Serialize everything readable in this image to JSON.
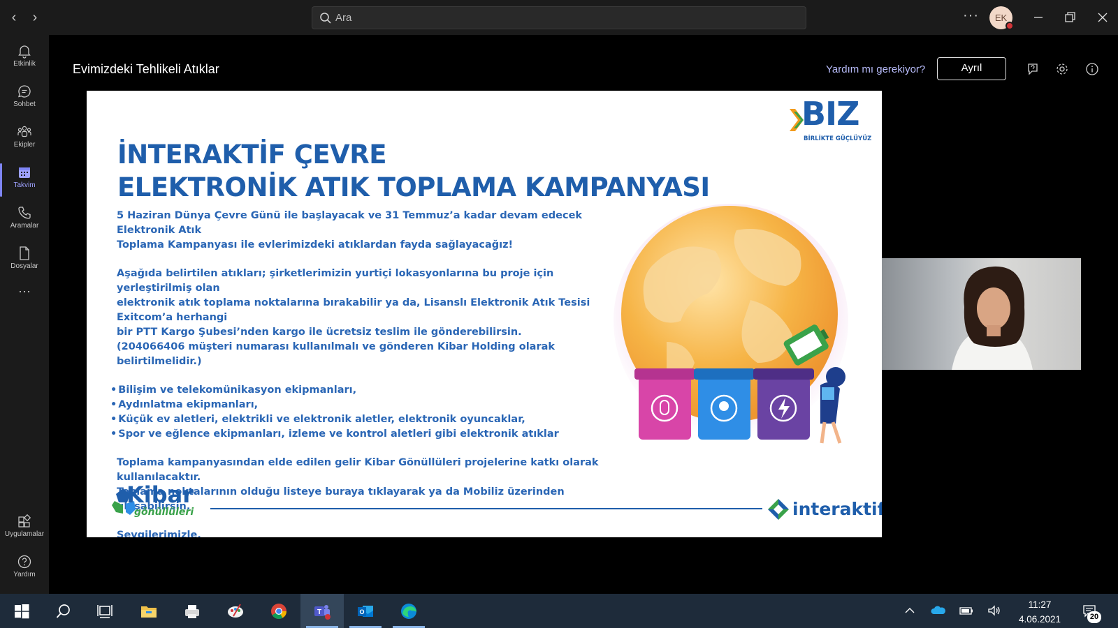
{
  "titlebar": {
    "search_placeholder": "Ara",
    "more_label": "···",
    "avatar_initials": "EK"
  },
  "rail": {
    "items": [
      {
        "label": "Etkinlik",
        "icon": "bell-icon"
      },
      {
        "label": "Sohbet",
        "icon": "chat-icon"
      },
      {
        "label": "Ekipler",
        "icon": "teams-icon"
      },
      {
        "label": "Takvim",
        "icon": "calendar-icon"
      },
      {
        "label": "Aramalar",
        "icon": "phone-icon"
      },
      {
        "label": "Dosyalar",
        "icon": "file-icon"
      }
    ],
    "more_label": "···",
    "bottom": [
      {
        "label": "Uygulamalar",
        "icon": "apps-icon"
      },
      {
        "label": "Yardım",
        "icon": "help-icon"
      }
    ],
    "active_index": 3
  },
  "meeting": {
    "title": "Evimizdeki Tehlikeli Atıklar",
    "help_link": "Yardım mı gerekiyor?",
    "leave_label": "Ayrıl"
  },
  "slide": {
    "heading_line1": "İNTERAKTİF ÇEVRE",
    "heading_line2": "ELEKTRONİK ATIK TOPLAMA KAMPANYASI",
    "para1_line1": "5 Haziran Dünya Çevre Günü ile başlayacak ve  31 Temmuz’a kadar devam edecek Elektronik Atık",
    "para1_line2": "Toplama Kampanyası ile evlerimizdeki atıklardan fayda sağlayacağız!",
    "para2_line1": "Aşağıda belirtilen atıkları; şirketlerimizin yurtiçi lokasyonlarına bu proje için yerleştirilmiş olan",
    "para2_line2": "elektronik atık toplama noktalarına bırakabilir ya da, Lisanslı Elektronik Atık Tesisi Exitcom’a herhangi",
    "para2_line3": "bir PTT Kargo Şubesi’nden kargo ile ücretsiz teslim ile gönderebilirsin.",
    "para2_line4": "(204066406 müşteri numarası kullanılmalı ve gönderen Kibar Holding olarak belirtilmelidir.)",
    "bullets": [
      "Bilişim ve telekomünikasyon ekipmanları,",
      "Aydınlatma ekipmanları,",
      "Küçük ev aletleri, elektrikli ve elektronik aletler, elektronik oyuncaklar,",
      "Spor ve eğlence ekipmanları, izleme ve kontrol aletleri gibi elektronik atıklar"
    ],
    "para3_line1": "Toplama kampanyasından elde edilen gelir Kibar Gönüllüleri projelerine katkı olarak kullanılacaktır.",
    "para3_line2": "Toplama noktalarının olduğu listeye buraya tıklayarak ya da Mobiliz üzerinden ulaşabilirsin.",
    "closing": "Sevgilerimizle.",
    "biz_logo": "BIZ",
    "biz_tagline": "BİRLİKTE GÜÇLÜYÜZ",
    "kibar_logo": "Kibar",
    "kibar_sub": "gönüllüleri",
    "interaktif_logo": "interaktif",
    "colors": {
      "text": "#2a66b5",
      "heading": "#1f5eab",
      "bin_pink": "#d845a8",
      "bin_blue": "#2f8ee6",
      "bin_purple": "#6a43a3",
      "globe": "#f3a93b"
    }
  },
  "taskbar": {
    "apps": [
      "windows-start-icon",
      "search-icon",
      "task-view-icon",
      "file-explorer-icon",
      "printer-icon",
      "paint-icon",
      "chrome-icon",
      "teams-icon",
      "outlook-icon",
      "edge-icon"
    ],
    "time": "11:27",
    "date": "4.06.2021",
    "notifications": "20"
  }
}
